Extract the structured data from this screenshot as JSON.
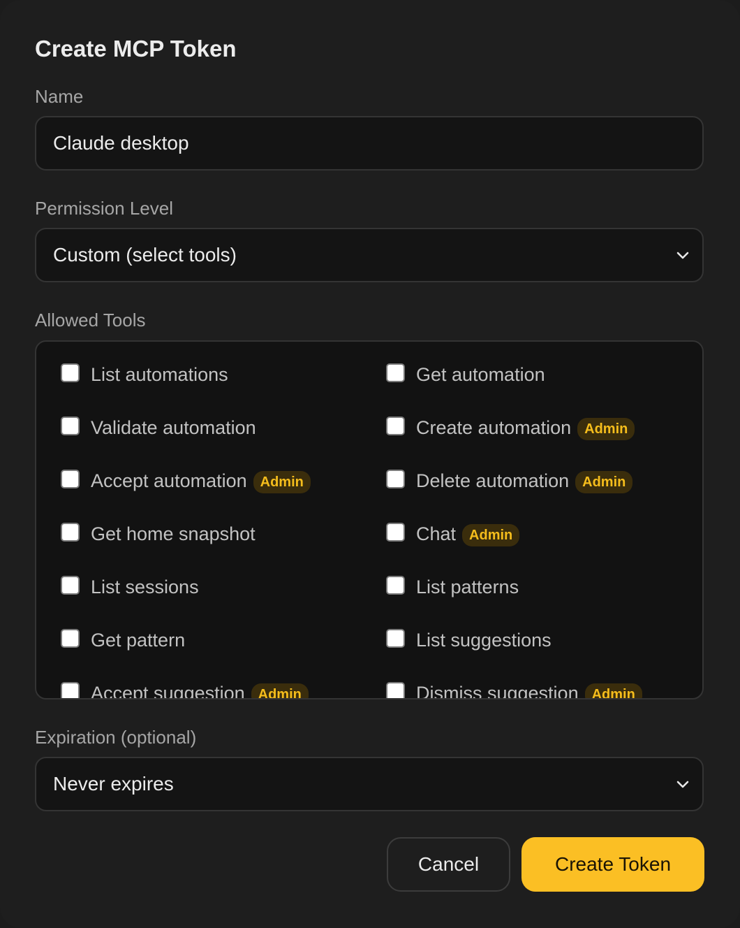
{
  "dialog": {
    "title": "Create MCP Token"
  },
  "name_field": {
    "label": "Name",
    "value": "Claude desktop"
  },
  "permission_field": {
    "label": "Permission Level",
    "selected": "Custom (select tools)",
    "icon": "chevron-down-icon"
  },
  "allowed_tools": {
    "label": "Allowed Tools",
    "items": [
      {
        "label": "List automations",
        "badge": "",
        "checked": false
      },
      {
        "label": "Get automation",
        "badge": "",
        "checked": false
      },
      {
        "label": "Validate automation",
        "badge": "",
        "checked": false
      },
      {
        "label": "Create automation",
        "badge": "Admin",
        "checked": false
      },
      {
        "label": "Accept automation",
        "badge": "Admin",
        "checked": false
      },
      {
        "label": "Delete automation",
        "badge": "Admin",
        "checked": false
      },
      {
        "label": "Get home snapshot",
        "badge": "",
        "checked": false
      },
      {
        "label": "Chat",
        "badge": "Admin",
        "checked": false
      },
      {
        "label": "List sessions",
        "badge": "",
        "checked": false
      },
      {
        "label": "List patterns",
        "badge": "",
        "checked": false
      },
      {
        "label": "Get pattern",
        "badge": "",
        "checked": false
      },
      {
        "label": "List suggestions",
        "badge": "",
        "checked": false
      },
      {
        "label": "Accept suggestion",
        "badge": "Admin",
        "checked": false
      },
      {
        "label": "Dismiss suggestion",
        "badge": "Admin",
        "checked": false
      }
    ]
  },
  "expiration_field": {
    "label": "Expiration (optional)",
    "selected": "Never expires",
    "icon": "chevron-down-icon"
  },
  "actions": {
    "cancel_label": "Cancel",
    "create_label": "Create Token"
  },
  "colors": {
    "accent": "#fbbf24",
    "badge_text": "#f5bd1c",
    "badge_bg": "#3a2d0c",
    "background": "#1e1e1e"
  }
}
